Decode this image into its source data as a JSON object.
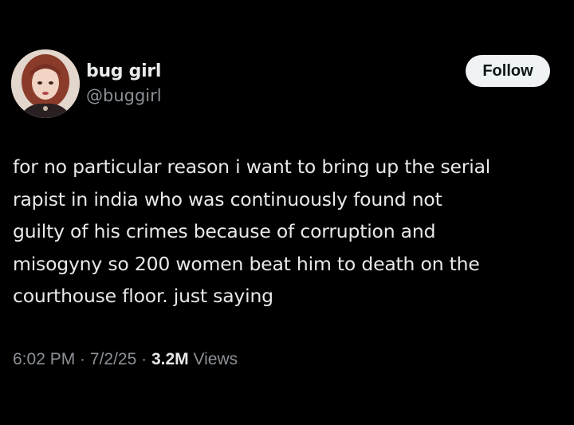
{
  "author": {
    "display_name": "bug girl",
    "handle": "@buggirl"
  },
  "follow_button": {
    "label": "Follow"
  },
  "tweet": {
    "lines": [
      "for no particular reason i want to bring up the serial",
      "rapist in india who was continuously found not",
      "guilty of his crimes because of corruption and",
      "misogyny so 200 women beat him to death on the",
      "courthouse floor. just saying"
    ]
  },
  "meta": {
    "time": "6:02 PM",
    "separator": " · ",
    "date": "7/2/25",
    "views_count": "3.2M",
    "views_label": " Views"
  },
  "colors": {
    "background": "#000000",
    "primary_text": "#e7e9ea",
    "secondary_text": "#8b9196",
    "follow_bg": "#eff3f4",
    "follow_text": "#0f1419"
  }
}
